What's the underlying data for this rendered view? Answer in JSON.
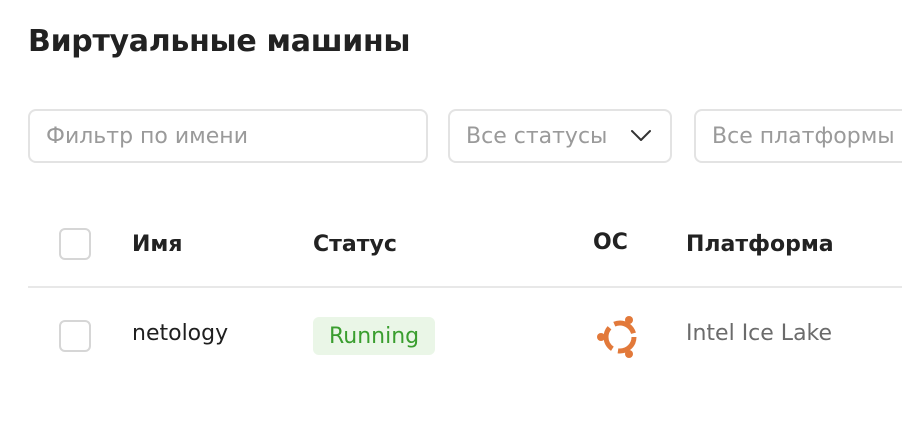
{
  "page": {
    "title": "Виртуальные машины"
  },
  "filters": {
    "name_placeholder": "Фильтр по имени",
    "status_value": "Все статусы",
    "platform_value": "Все платформы"
  },
  "table": {
    "columns": {
      "name": "Имя",
      "status": "Статус",
      "os": "ОС",
      "platform": "Платформа"
    },
    "rows": [
      {
        "name": "netology",
        "status": "Running",
        "os_icon": "ubuntu-icon",
        "platform": "Intel Ice Lake"
      }
    ]
  },
  "colors": {
    "status_running_text": "#3a9e2f",
    "status_running_bg": "#eaf6e7",
    "ubuntu_orange": "#e2793a"
  }
}
